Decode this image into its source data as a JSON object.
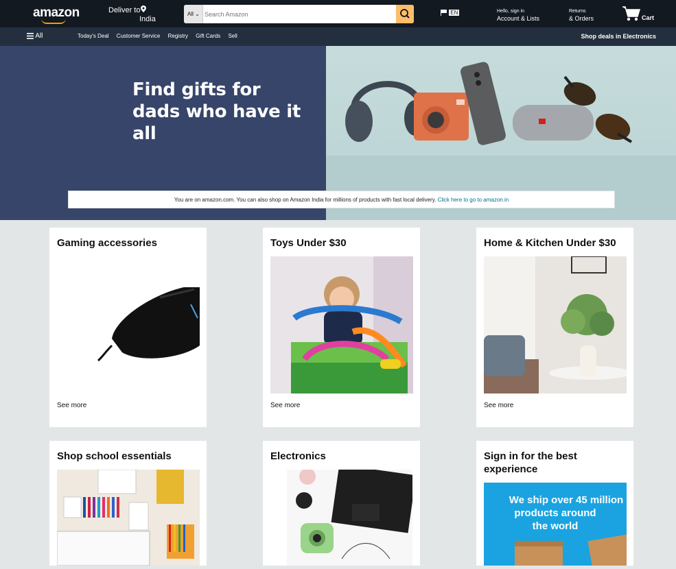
{
  "header": {
    "logo": "amazon",
    "deliver_to": "Deliver to",
    "deliver_location": "India",
    "search_category": "All",
    "search_placeholder": "Search Amazon",
    "language": "EN",
    "account_line1": "Hello, sign in",
    "account_line2": "Account & Lists",
    "returns_line1": "Returns",
    "returns_line2": "& Orders",
    "cart_label": "Cart"
  },
  "nav": {
    "all_label": "All",
    "links": [
      "Today's Deal",
      "Customer Service",
      "Registry",
      "Gift Cards",
      "Sell"
    ],
    "deals_label": "Shop deals in Electronics"
  },
  "hero": {
    "title_line1": "Find gifts for",
    "title_line2": "dads who have it all",
    "notice_text": "You are on amazon.com. You can also shop on Amazon India for millions of products with fast local delivery.",
    "notice_link": "Click here to go to amazon.in",
    "left_color": "#37456a"
  },
  "cards": [
    {
      "title": "Gaming accessories",
      "see_more": "See more"
    },
    {
      "title": "Toys Under $30",
      "see_more": "See more"
    },
    {
      "title": "Home & Kitchen Under $30",
      "see_more": "See more"
    },
    {
      "title": "Shop school essentials"
    },
    {
      "title": "Electronics"
    },
    {
      "title": "Sign in for the best experience",
      "promo_line1": "We ship over 45 million",
      "promo_line2": "products around",
      "promo_line3": "the world"
    }
  ],
  "colors": {
    "accent": "#febd69",
    "header_bg": "#131921",
    "nav_bg": "#232f3e",
    "link": "#007185"
  }
}
